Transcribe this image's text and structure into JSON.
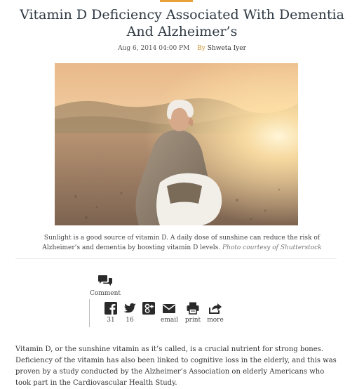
{
  "article": {
    "title": "Vitamin D Deficiency Associated With Dementia And Alzheimer’s",
    "date": "Aug 6, 2014 04:00 PM",
    "by_label": "By",
    "author": "Shweta Iyer",
    "image_alt": "Elderly woman sitting on a beach at sunset wrapped in a shawl",
    "caption": "Sunlight is a good source of vitamin D. A daily dose of sunshine can reduce the risk of Alzheimer’s and dementia by boosting vitamin D levels.",
    "photo_credit": "Photo courtesy of Shutterstock",
    "body": "Vitamin D, or the sunshine vitamin as it’s called, is a crucial nutrient for strong bones. Deficiency of the vitamin has also been linked to cognitive loss in the elderly, and this was proven by a study conducted by the Alzheimer’s Association on elderly Americans who took part in the Cardiovascular Health Study."
  },
  "comment": {
    "label": "Comment",
    "icon": "speech-bubbles-icon"
  },
  "share": {
    "facebook": {
      "icon": "facebook-icon",
      "count": "31"
    },
    "twitter": {
      "icon": "twitter-icon",
      "count": "16"
    },
    "googleplus": {
      "icon": "google-plus-icon"
    },
    "email": {
      "icon": "envelope-icon",
      "label": "email"
    },
    "print": {
      "icon": "printer-icon",
      "label": "print"
    },
    "more": {
      "icon": "share-arrow-icon",
      "label": "more"
    }
  },
  "colors": {
    "accent": "#e8a13a",
    "title": "#2f3a44",
    "byline": "#c9922e",
    "icon": "#2a2a2a"
  }
}
